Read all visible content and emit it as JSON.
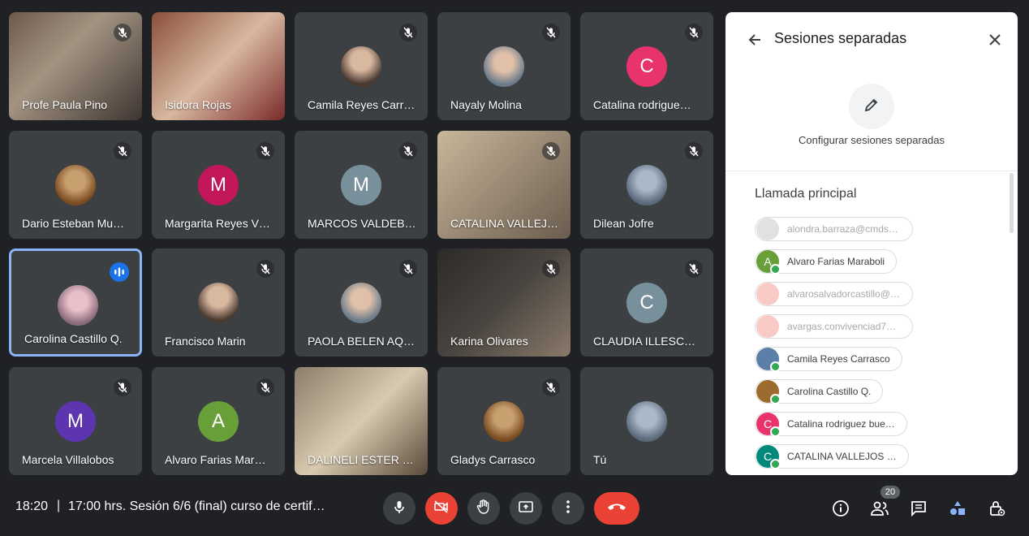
{
  "participants": [
    {
      "name": "Profe Paula Pino",
      "mic": "muted",
      "display": "video"
    },
    {
      "name": "Isidora Rojas",
      "mic": "none",
      "display": "video"
    },
    {
      "name": "Camila Reyes Carr…",
      "mic": "muted",
      "display": "photo"
    },
    {
      "name": "Nayaly Molina",
      "mic": "muted",
      "display": "photo"
    },
    {
      "name": "Catalina rodrigue…",
      "mic": "muted",
      "display": "letter",
      "initial": "C",
      "color": "#e8336d"
    },
    {
      "name": "Dario Esteban Mu…",
      "mic": "muted",
      "display": "photo"
    },
    {
      "name": "Margarita Reyes V…",
      "mic": "muted",
      "display": "letter",
      "initial": "M",
      "color": "#c2185b"
    },
    {
      "name": "MARCOS VALDEB…",
      "mic": "muted",
      "display": "letter",
      "initial": "M",
      "color": "#78909c"
    },
    {
      "name": "CATALINA VALLEJ…",
      "mic": "muted",
      "display": "video"
    },
    {
      "name": "Dilean Jofre",
      "mic": "muted",
      "display": "photo"
    },
    {
      "name": "Carolina Castillo Q.",
      "mic": "active",
      "display": "photo",
      "speaking": true
    },
    {
      "name": "Francisco Marin",
      "mic": "muted",
      "display": "photo"
    },
    {
      "name": "PAOLA BELEN AQ…",
      "mic": "muted",
      "display": "photo"
    },
    {
      "name": "Karina Olivares",
      "mic": "muted",
      "display": "video"
    },
    {
      "name": "CLAUDIA ILLESC…",
      "mic": "muted",
      "display": "letter",
      "initial": "C",
      "color": "#78909c"
    },
    {
      "name": "Marcela Villalobos",
      "mic": "muted",
      "display": "letter",
      "initial": "M",
      "color": "#5e35b1"
    },
    {
      "name": "Alvaro Farias Mar…",
      "mic": "muted",
      "display": "letter",
      "initial": "A",
      "color": "#689f38"
    },
    {
      "name": "DALINELI ESTER P…",
      "mic": "none",
      "display": "video"
    },
    {
      "name": "Gladys Carrasco",
      "mic": "muted",
      "display": "photo"
    },
    {
      "name": "Tú",
      "mic": "none",
      "display": "photo"
    }
  ],
  "panel": {
    "title": "Sesiones separadas",
    "config_label": "Configurar sesiones separadas",
    "section_title": "Llamada principal",
    "members": [
      {
        "label": "alondra.barraza@cmdsa…",
        "dim": true,
        "initial": "",
        "color": "#bdbdbd"
      },
      {
        "label": "Alvaro Farias Maraboli",
        "dim": false,
        "initial": "A",
        "color": "#689f38"
      },
      {
        "label": "alvarosalvadorcastillo@g…",
        "dim": true,
        "initial": "",
        "color": "#f28b82"
      },
      {
        "label": "avargas.convivenciad72…",
        "dim": true,
        "initial": "",
        "color": "#f28b82"
      },
      {
        "label": "Camila Reyes Carrasco",
        "dim": false,
        "initial": "",
        "color": "#5b7fa8"
      },
      {
        "label": "Carolina Castillo Q.",
        "dim": false,
        "initial": "",
        "color": "#9c6b2e"
      },
      {
        "label": "Catalina rodriguez bue…",
        "dim": false,
        "initial": "C",
        "color": "#e8336d"
      },
      {
        "label": "CATALINA VALLEJOS …",
        "dim": false,
        "initial": "C",
        "color": "#00897b"
      }
    ]
  },
  "bottom_bar": {
    "time": "18:20",
    "separator": "|",
    "meeting_title": "17:00 hrs. Sesión 6/6 (final) curso de certif…",
    "participant_count": "20"
  },
  "colors": {
    "background": "#202124",
    "tile": "#3c4043",
    "speaking_border": "#8ab4f8",
    "end_call": "#ea4335",
    "accent_blue": "#1a73e8"
  }
}
